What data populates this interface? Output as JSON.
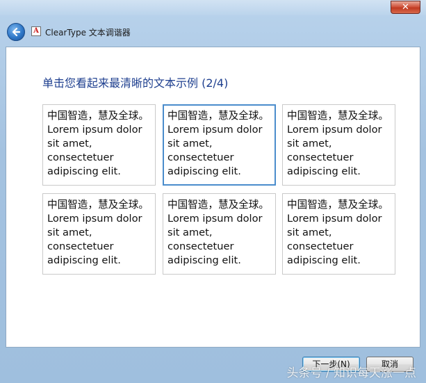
{
  "window": {
    "title": "ClearType 文本调谐器",
    "close_label": "✕"
  },
  "heading": "单击您看起来最清晰的文本示例 (2/4)",
  "samples": [
    {
      "zh": "中国智造，慧及全球。",
      "en": "Lorem ipsum dolor\nsit amet,\nconsectetuer\nadipiscing elit.",
      "selected": false
    },
    {
      "zh": "中国智造，慧及全球。",
      "en": "Lorem ipsum dolor\nsit amet,\nconsectetuer\nadipiscing elit.",
      "selected": true
    },
    {
      "zh": "中国智造，慧及全球。",
      "en": "Lorem ipsum dolor\nsit amet,\nconsectetuer\nadipiscing elit.",
      "selected": false
    },
    {
      "zh": "中国智造，慧及全球。",
      "en": "Lorem ipsum dolor\nsit amet,\nconsectetuer\nadipiscing elit.",
      "selected": false
    },
    {
      "zh": "中国智造，慧及全球。",
      "en": "Lorem ipsum dolor\nsit amet,\nconsectetuer\nadipiscing elit.",
      "selected": false
    },
    {
      "zh": "中国智造，慧及全球。",
      "en": "Lorem ipsum dolor\nsit amet,\nconsectetuer\nadipiscing elit.",
      "selected": false
    }
  ],
  "buttons": {
    "next": "下一步(N)",
    "cancel": "取消"
  },
  "watermark": "头条号 / 知识每天涨一点",
  "colors": {
    "heading": "#1e3f8f",
    "selection_border": "#4a8ccc",
    "close_button": "#c03a22"
  },
  "icons": {
    "back": "back-arrow-icon",
    "app": "cleartype-app-icon",
    "close": "close-icon"
  }
}
